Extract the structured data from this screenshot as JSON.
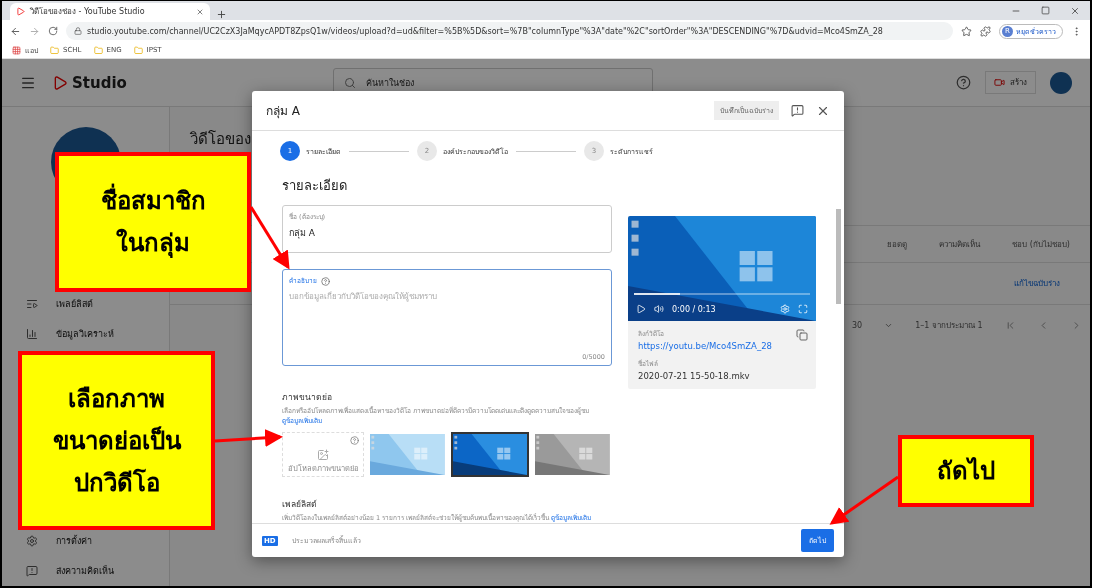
{
  "browser": {
    "tab_title": "วิดีโอของช่อง - YouTube Studio",
    "url": "studio.youtube.com/channel/UC2CzX3JaMqycAPDT8ZpsQ1w/videos/upload?d=ud&filter=%5B%5D&sort=%7B\"columnType\"%3A\"date\"%2C\"sortOrder\"%3A\"DESCENDING\"%7D&udvid=Mco4SmZA_28",
    "profile_initial": "R",
    "profile_label": "หยุดชั่วคราว",
    "bookmarks": [
      {
        "kind": "apps",
        "label": "แอป"
      },
      {
        "kind": "folder",
        "label": "SCHL"
      },
      {
        "kind": "folder",
        "label": "ENG"
      },
      {
        "kind": "folder",
        "label": "IPST"
      }
    ]
  },
  "studio": {
    "logo": "Studio",
    "search_placeholder": "ค้นหาในช่อง",
    "create_label": "สร้าง",
    "sidebar_top": [
      {
        "kind": "playlist",
        "label": "เพลย์ลิสต์"
      },
      {
        "kind": "analytics",
        "label": "ข้อมูลวิเคราะห์"
      }
    ],
    "sidebar_bottom": [
      {
        "kind": "settings",
        "label": "การตั้งค่า"
      },
      {
        "kind": "feedback",
        "label": "ส่งความคิดเห็น"
      }
    ],
    "page_title": "วิดีโอของ",
    "columns": [
      "ยอดดู",
      "ความคิดเห็น",
      "ชอบ (กับไม่ชอบ)"
    ],
    "row_action": "แก้ไขฉบับร่าง",
    "pagination": {
      "rows_per_page": "30",
      "range": "1–1 จากประมาณ 1"
    }
  },
  "dialog": {
    "title": "กลุ่ม A",
    "save_draft": "บันทึกเป็นฉบับร่าง",
    "steps": [
      {
        "number": "1",
        "label": "รายละเอียด",
        "selected": true
      },
      {
        "number": "2",
        "label": "องค์ประกอบของวิดีโอ",
        "selected": false
      },
      {
        "number": "3",
        "label": "ระดับการแชร์",
        "selected": false
      }
    ],
    "heading": "รายละเอียด",
    "title_field": {
      "label": "ชื่อ (ต้องระบุ)",
      "value": "กลุ่ม A"
    },
    "description_field": {
      "label": "คำอธิบาย",
      "placeholder": "บอกข้อมูลเกี่ยวกับวิดีโอของคุณให้ผู้ชมทราบ",
      "counter": "0/5000"
    },
    "video": {
      "time": "0:00 / 0:13",
      "buffer": {
        "level": 0.26
      },
      "link_label": "ลิงก์วิดีโอ",
      "link": "https://youtu.be/Mco4SmZA_28",
      "file_label": "ชื่อไฟล์",
      "file_name": "2020-07-21 15-50-18.mkv"
    },
    "thumbnail_section": {
      "heading": "ภาพขนาดย่อ",
      "description": "เลือกหรืออัปโหลดภาพเพื่อแสดงเนื้อหาของวิดีโอ ภาพขนาดย่อที่ดีควรมีความโดดเด่นและดึงดูดความสนใจของผู้ชม",
      "link": "ดูข้อมูลเพิ่มเติม",
      "upload_label": "อัปโหลดภาพขนาดย่อ",
      "thumbnails": [
        {
          "kind": "light",
          "selected": false
        },
        {
          "kind": "dark",
          "selected": true
        },
        {
          "kind": "gray",
          "selected": false
        }
      ]
    },
    "playlist_section": {
      "heading": "เพลย์ลิสต์",
      "description": "เพิ่มวิดีโอลงในเพลย์ลิสต์อย่างน้อย 1 รายการ เพลย์ลิสต์จะช่วยให้ผู้ชมค้นพบเนื้อหาของคุณได้เร็วขึ้น",
      "link": "ดูข้อมูลเพิ่มเติม"
    },
    "footer": {
      "badge": "HD",
      "status": "ประมวลผลเสร็จสิ้นแล้ว",
      "next": "ถัดไป"
    }
  },
  "annotations": [
    {
      "lines": [
        "ชื่อสมาชิก",
        "ในกลุ่ม"
      ]
    },
    {
      "lines": [
        "เลือกภาพ",
        "ขนาดย่อเป็น",
        "ปกวิดีโอ"
      ]
    },
    {
      "lines": [
        "ถัดไป"
      ]
    }
  ]
}
